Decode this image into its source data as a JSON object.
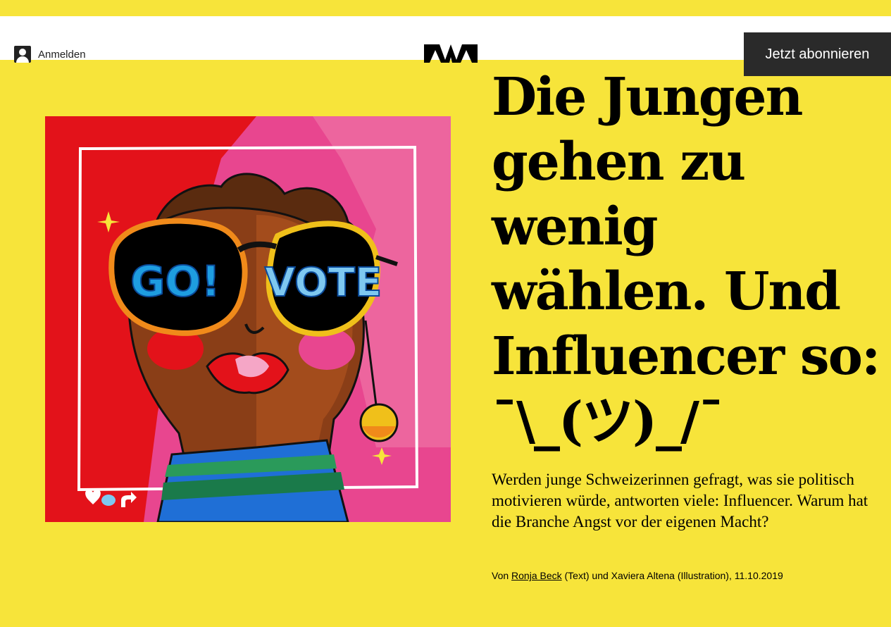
{
  "header": {
    "login_label": "Anmelden",
    "subscribe_label": "Jetzt abonnieren"
  },
  "article": {
    "headline": "Die Jungen gehen zu wenig wählen. Und Influencer so: ¯\\_(ツ)_/¯",
    "lead": "Werden junge Schweizerinnen gefragt, was sie politisch motivieren würde, antworten viele: Influencer. Warum hat die Branche Angst vor der eigenen Macht?",
    "byline": {
      "prefix": "Von",
      "author": "Ronja Beck",
      "suffix": "(Text) und Xaviera Altena (Illustration), 11.10.2019"
    }
  },
  "illustration": {
    "left_lens_text": "GO!",
    "right_lens_text": "VOTE"
  },
  "colors": {
    "background": "#f7e43a",
    "header_bg": "#ffffff",
    "subscribe_bg": "#2a2a2a",
    "illustration_red": "#e3121a",
    "illustration_pink": "#e8468f"
  }
}
